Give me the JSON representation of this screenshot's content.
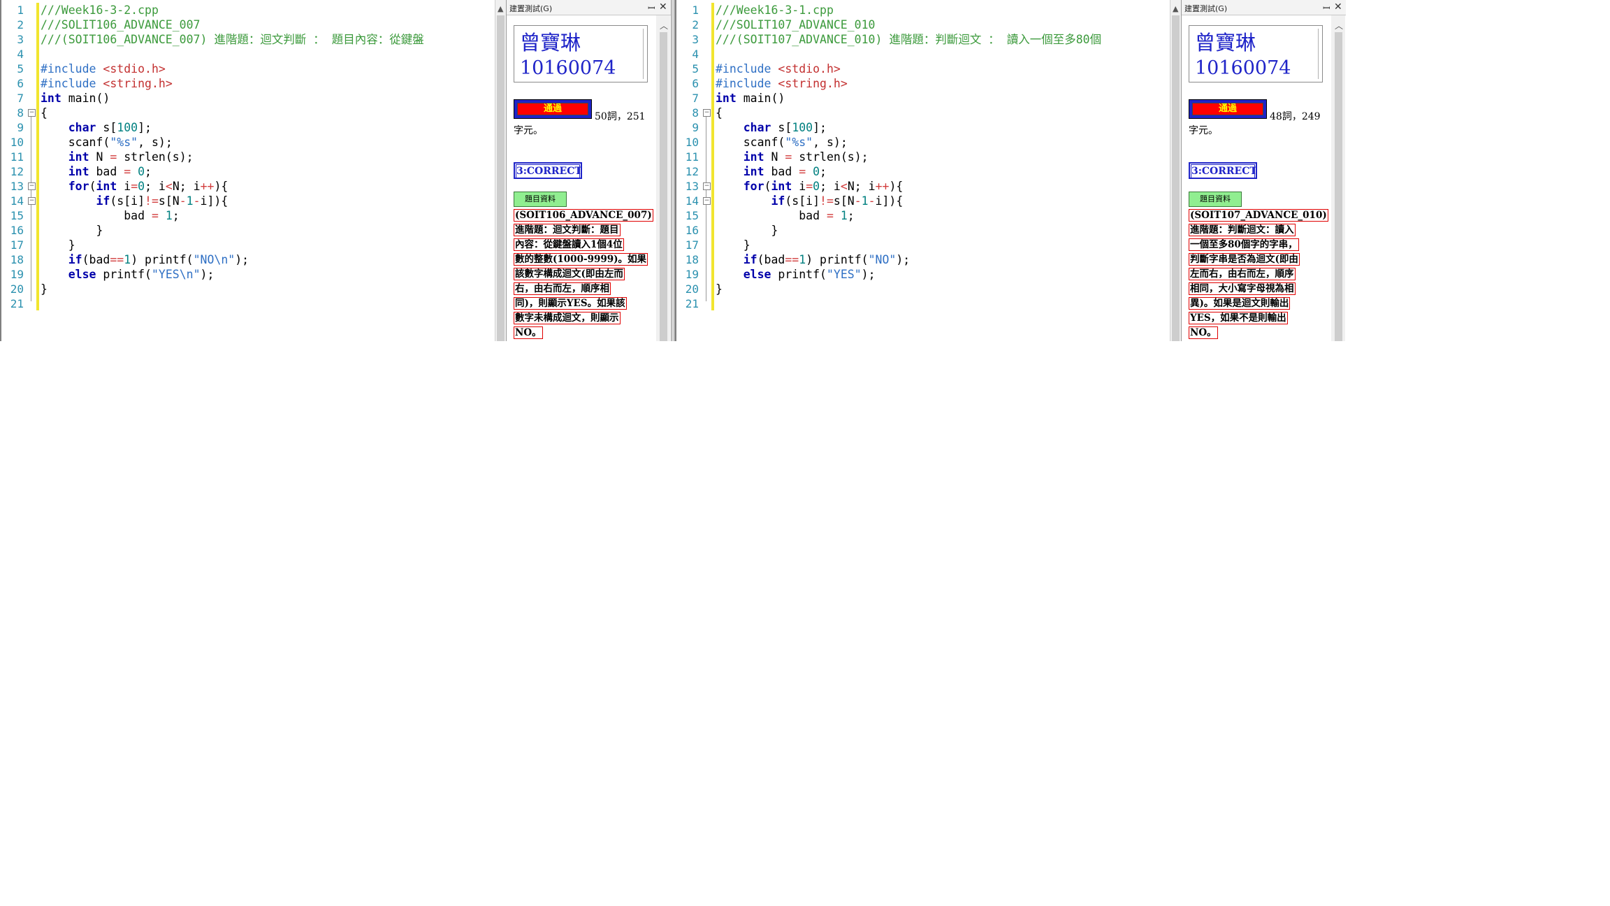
{
  "left": {
    "panel": {
      "title": "建置測試(G)",
      "pin": "ꟷ",
      "close": "✕",
      "name": "曾寶琳",
      "student_id": "10160074",
      "pass_label": "通過",
      "stats_line1": "50詞，251",
      "stats_line2": "字元。",
      "result": "3:CORRECT",
      "info_button": "題目資料",
      "desc_lines": [
        "(SOIT106_ADVANCE_007)",
        "進階題：迴文判斷：題目",
        "內容：從鍵盤讀入1個4位",
        "數的整數(1000-9999)。如果",
        "該數字構成迴文(即由左而",
        "右，由右而左，順序相",
        "同)，則顯示YES。如果該",
        "數字未構成迴文，則顯示",
        "NO。"
      ]
    },
    "line_numbers": [
      "1",
      "2",
      "3",
      "4",
      "5",
      "6",
      "7",
      "8",
      "9",
      "10",
      "11",
      "12",
      "13",
      "14",
      "15",
      "16",
      "17",
      "18",
      "19",
      "20",
      "21"
    ],
    "code": {
      "l1": "///Week16-3-2.cpp",
      "l2": "///SOLIT106_ADVANCE_007",
      "l3": "///(SOIT106_ADVANCE_007) 進階題：迴文判斷 ： 題目內容：從鍵盤",
      "inc_kw": "#include",
      "inc1": "<stdio.h>",
      "inc2": "<string.h>",
      "printf_no": "\"NO\\n\"",
      "printf_yes": "\"YES\\n\""
    }
  },
  "right": {
    "panel": {
      "title": "建置測試(G)",
      "pin": "ꟷ",
      "close": "✕",
      "name": "曾寶琳",
      "student_id": "10160074",
      "pass_label": "通過",
      "stats_line1": "48詞，249",
      "stats_line2": "字元。",
      "result": "3:CORRECT",
      "info_button": "題目資料",
      "desc_lines": [
        "(SOIT107_ADVANCE_010)",
        "進階題：判斷迴文：讀入",
        "一個至多80個字的字串，",
        "判斷字串是否為迴文(即由",
        "左而右，由右而左，順序",
        "相同，大小寫字母視為相",
        "異)。如果是迴文則輸出",
        "YES，如果不是則輸出",
        "NO。"
      ]
    },
    "line_numbers": [
      "1",
      "2",
      "3",
      "4",
      "5",
      "6",
      "7",
      "8",
      "9",
      "10",
      "11",
      "12",
      "13",
      "14",
      "15",
      "16",
      "17",
      "18",
      "19",
      "20",
      "21"
    ],
    "code": {
      "l1": "///Week16-3-1.cpp",
      "l2": "///SOLIT107_ADVANCE_010",
      "l3": "///(SOIT107_ADVANCE_010) 進階題：判斷迴文 ： 讀入一個至多80個",
      "inc_kw": "#include",
      "inc1": "<stdio.h>",
      "inc2": "<string.h>",
      "printf_no": "\"NO\"",
      "printf_yes": "\"YES\""
    }
  },
  "shared_code": {
    "int": "int",
    "main": " main()",
    "lbrace": "{",
    "rbrace": "}",
    "char": "char",
    "s100_a": " s[",
    "n100": "100",
    "s100_b": "];",
    "scanf_a": "scanf(",
    "scanf_fmt": "\"%s\"",
    "scanf_b": ", s);",
    "n_decl_a": " N ",
    "eq": "=",
    "strlen": " strlen(s);",
    "bad_decl": " bad ",
    "zero": "0",
    "semi": ";",
    "for": "for",
    "for_a": "(",
    "i_eq": " i",
    "for_b": "; i",
    "lt": "<",
    "for_c": "N; i",
    "pp": "++",
    "for_d": "){",
    "if": "if",
    "if_a": "(s[i]",
    "neq": "!=",
    "if_b": "s[N",
    "minus": "-",
    "one": "1",
    "if_c": "i]){",
    "bad_assign": "bad ",
    "bad_if_a": "(bad",
    "eqeq": "==",
    "bad_if_b": ") printf(",
    "close_paren": ");",
    "else": "else",
    "printf_a": " printf("
  }
}
